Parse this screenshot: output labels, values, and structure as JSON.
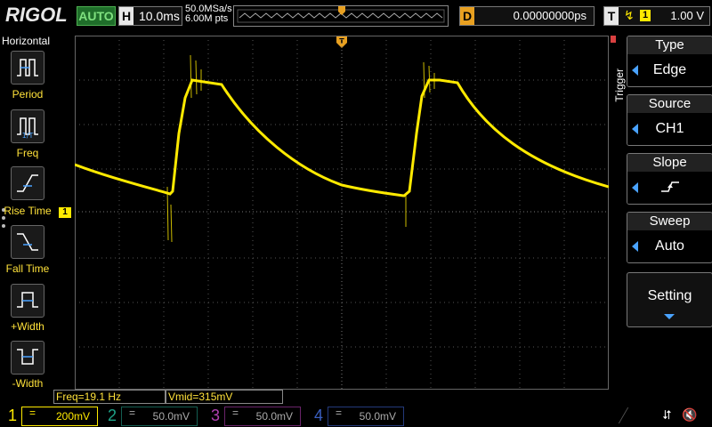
{
  "header": {
    "brand": "RIGOL",
    "run_status": "AUTO",
    "timebase_key": "H",
    "timebase": "10.0ms",
    "sample_rate": "50.0MSa/s",
    "memory_depth": "6.00M pts",
    "delay_key": "D",
    "delay": "0.00000000ps",
    "trigger_key": "T",
    "trigger_channel": "1",
    "trigger_level": "1.00 V"
  },
  "left_menu": {
    "title": "Horizontal",
    "items": [
      {
        "label": "Period",
        "icon": "period-icon"
      },
      {
        "label": "Freq",
        "icon": "freq-icon"
      },
      {
        "label": "Rise Time",
        "icon": "rise-time-icon"
      },
      {
        "label": "Fall Time",
        "icon": "fall-time-icon"
      },
      {
        "label": "+Width",
        "icon": "positive-width-icon"
      },
      {
        "label": "-Width",
        "icon": "negative-width-icon"
      }
    ]
  },
  "right_menu": {
    "title": "Trigger",
    "items": [
      {
        "title": "Type",
        "value": "Edge"
      },
      {
        "title": "Source",
        "value": "CH1"
      },
      {
        "title": "Slope",
        "value": "rising-edge-icon"
      },
      {
        "title": "Sweep",
        "value": "Auto"
      }
    ],
    "setting": "Setting"
  },
  "measurements": {
    "freq": "Freq=19.1 Hz",
    "vmid": "Vmid=315mV"
  },
  "channels": [
    {
      "num": "1",
      "scale": "200mV",
      "color": "#ffea00",
      "active": true
    },
    {
      "num": "2",
      "scale": "50.0mV",
      "color": "#1fa38a",
      "active": false
    },
    {
      "num": "3",
      "scale": "50.0mV",
      "color": "#b040b0",
      "active": false
    },
    {
      "num": "4",
      "scale": "50.0mV",
      "color": "#3a5fc0",
      "active": false
    }
  ],
  "ch1_marker": "1",
  "colors": {
    "trace": "#ffea00",
    "accent": "#4aa3ff",
    "trigger": "#e8a020"
  }
}
